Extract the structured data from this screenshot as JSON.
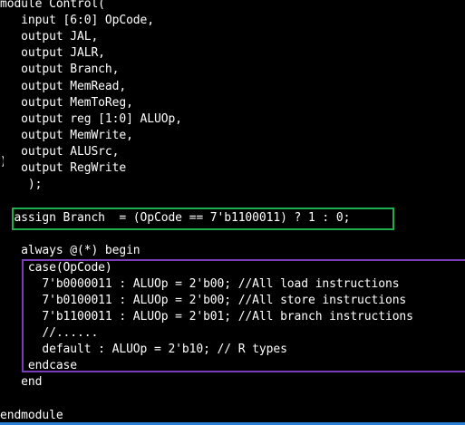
{
  "code": {
    "lines": [
      "module Control(",
      "   input [6:0] OpCode,",
      "   output JAL,",
      "   output JALR,",
      "   output Branch,",
      "   output MemRead,",
      "   output MemToReg,",
      "   output reg [1:0] ALUOp,",
      "   output MemWrite,",
      "   output ALUSrc,",
      "   output RegWrite",
      "    );",
      "",
      "  assign Branch  = (OpCode == 7'b1100011) ? 1 : 0;",
      "",
      "   always @(*) begin",
      "    case(OpCode)",
      "      7'b0000011 : ALUOp = 2'b00; //All load instructions",
      "      7'b0100011 : ALUOp = 2'b00; //All store instructions",
      "      7'b1100011 : ALUOp = 2'b01; //All branch instructions",
      "      //......",
      "      default : ALUOp = 2'b10; // R types",
      "    endcase",
      "   end",
      "",
      "endmodule"
    ]
  },
  "colors": {
    "background": "#000000",
    "text": "#ffffff",
    "assign_highlight": "#1fae4b",
    "case_highlight": "#7a3db8",
    "bottom_bar": "#2d7fd3"
  }
}
